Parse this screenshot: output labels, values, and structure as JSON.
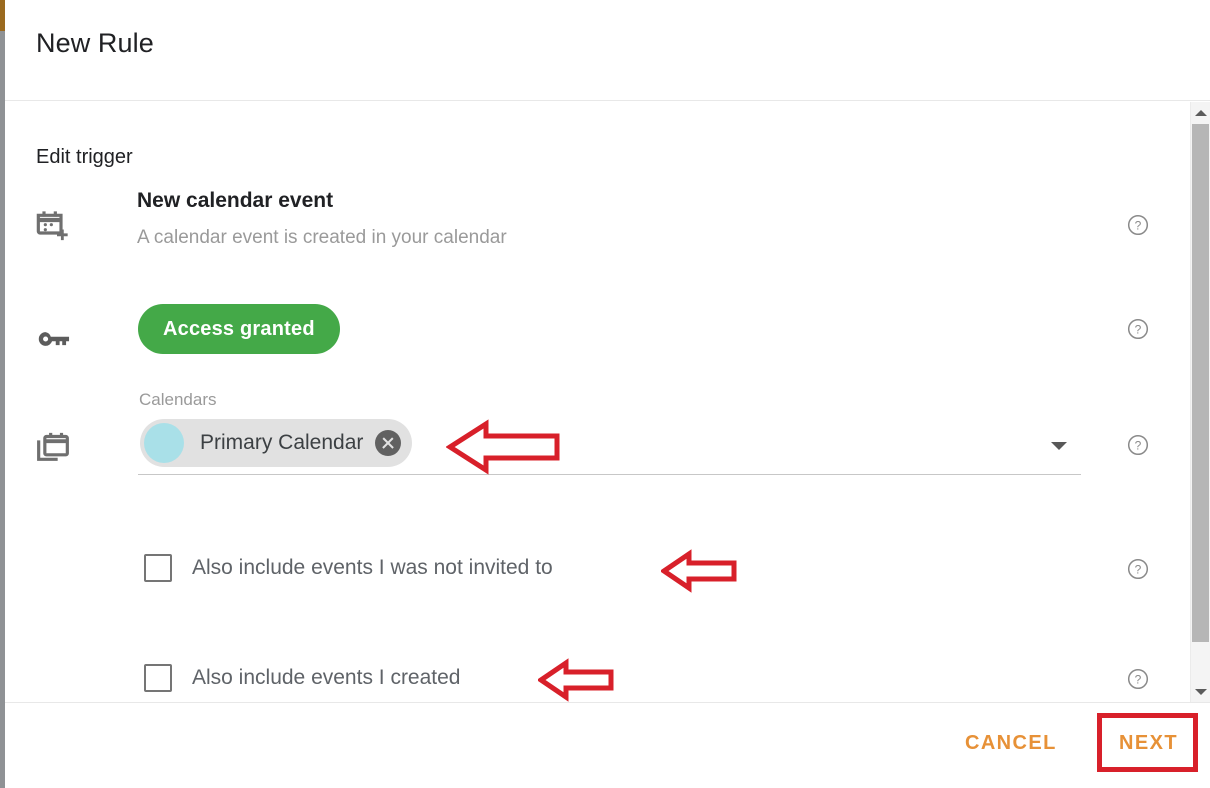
{
  "dialog": {
    "title": "New Rule",
    "section_label": "Edit trigger"
  },
  "trigger": {
    "icon": "calendar-add-icon",
    "title": "New calendar event",
    "subtitle": "A calendar event is created in your calendar",
    "help_label": "?"
  },
  "access": {
    "icon": "key-icon",
    "pill_label": "Access granted",
    "pill_color": "#44a948",
    "help_label": "?"
  },
  "calendars": {
    "icon": "calendars-icon",
    "field_label": "Calendars",
    "chip": {
      "label": "Primary Calendar",
      "avatar_color": "#a9e0e8",
      "remove_icon": "close-circle-icon"
    },
    "dropdown_icon": "chevron-down-icon",
    "help_label": "?"
  },
  "options": [
    {
      "label": "Also include events I was not invited to",
      "checked": false,
      "help_label": "?"
    },
    {
      "label": "Also include events I created",
      "checked": false,
      "help_label": "?"
    }
  ],
  "footer": {
    "cancel_label": "CANCEL",
    "next_label": "NEXT",
    "accent_color": "#e79137"
  },
  "scrollbar": {
    "up_icon": "scroll-up-arrow-icon",
    "down_icon": "scroll-down-arrow-icon"
  },
  "annotations": {
    "color": "#d8202a",
    "arrows": [
      "arrow-pointing-to-calendar-chip",
      "arrow-pointing-to-not-invited-checkbox",
      "arrow-pointing-to-created-checkbox"
    ],
    "highlight_box": "next-button-highlight"
  }
}
